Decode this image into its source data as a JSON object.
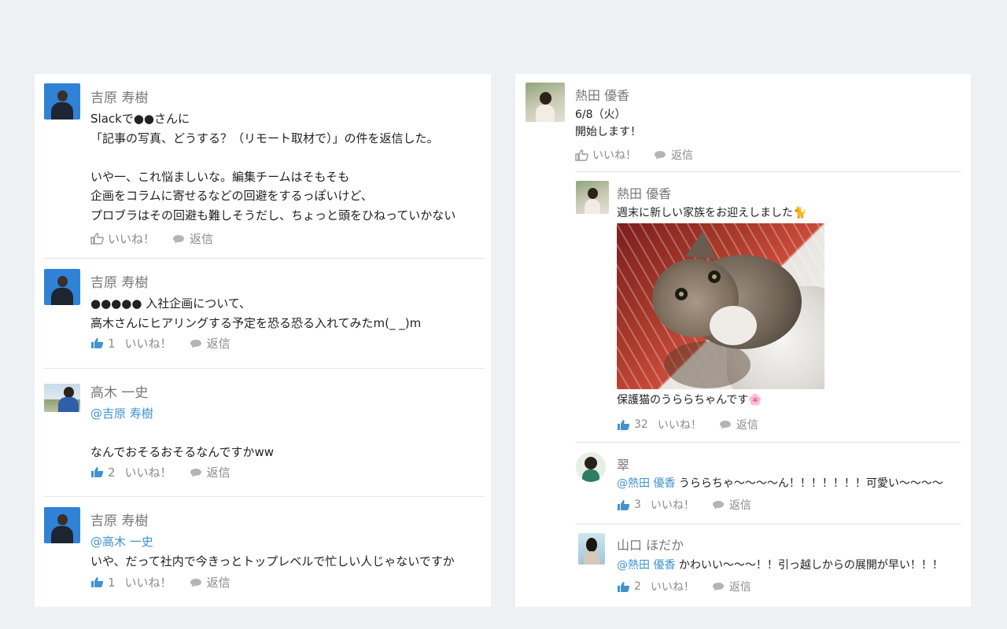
{
  "left_thread": {
    "posts": [
      {
        "author": "吉原 寿樹",
        "lines": [
          "Slackで●●さんに",
          "「記事の写真、どうする？（リモート取材で）」の件を返信した。",
          "",
          "いや一、これ悩ましいな。編集チームはそもそも",
          "企画をコラムに寄せるなどの回避をするっぽいけど、",
          "プロブラはその回避も難しそうだし、ちょっと頭をひねっていかない"
        ],
        "like_label": "いいね！",
        "reply_label": "返信"
      },
      {
        "author": "吉原 寿樹",
        "lines": [
          "●●●●● 入社企画について、",
          "高木さんにヒアリングする予定を恐る恐る入れてみたm(_ _)m"
        ],
        "like_count": "1",
        "like_label": "いいね！",
        "reply_label": "返信"
      },
      {
        "author": "高木 一史",
        "mention": "@吉原 寿樹",
        "lines": [
          "",
          "なんでおそるおそるなんですかww"
        ],
        "like_count": "2",
        "like_label": "いいね！",
        "reply_label": "返信"
      },
      {
        "author": "吉原 寿樹",
        "mention": "@高木 一史",
        "lines": [
          "いや、だって社内で今きっとトップレベルで忙しい人じゃないですか"
        ],
        "like_count": "1",
        "like_label": "いいね！",
        "reply_label": "返信"
      }
    ]
  },
  "right_thread": {
    "post": {
      "author": "熱田 優香",
      "lines": [
        "6/8（火）",
        "開始します！"
      ],
      "like_label": "いいね！",
      "reply_label": "返信"
    },
    "replies": [
      {
        "author": "熱田 優香",
        "text_before": "週末に新しい家族をお迎えしました🐈",
        "text_after": "保護猫のうららちゃんです🌸",
        "like_count": "32",
        "like_label": "いいね！",
        "reply_label": "返信"
      },
      {
        "author": "翠",
        "mention": "@熱田 優香",
        "text": "うららちゃ〜〜〜〜ん！！！！！！！可愛い〜〜〜〜",
        "like_count": "3",
        "like_label": "いいね！",
        "reply_label": "返信"
      },
      {
        "author": "山口 ほだか",
        "mention": "@熱田 優香",
        "text": "かわいい〜〜〜！！引っ越しからの展開が早い！！！",
        "like_count": "2",
        "like_label": "いいね！",
        "reply_label": "返信"
      }
    ]
  },
  "icons": {
    "like": "thumbs-up-icon",
    "reply": "speech-bubble-icon"
  },
  "colors": {
    "background": "#edf1f4",
    "mention": "#3f93cf",
    "like_active": "#3f93cf",
    "muted": "#8a8a8a"
  }
}
